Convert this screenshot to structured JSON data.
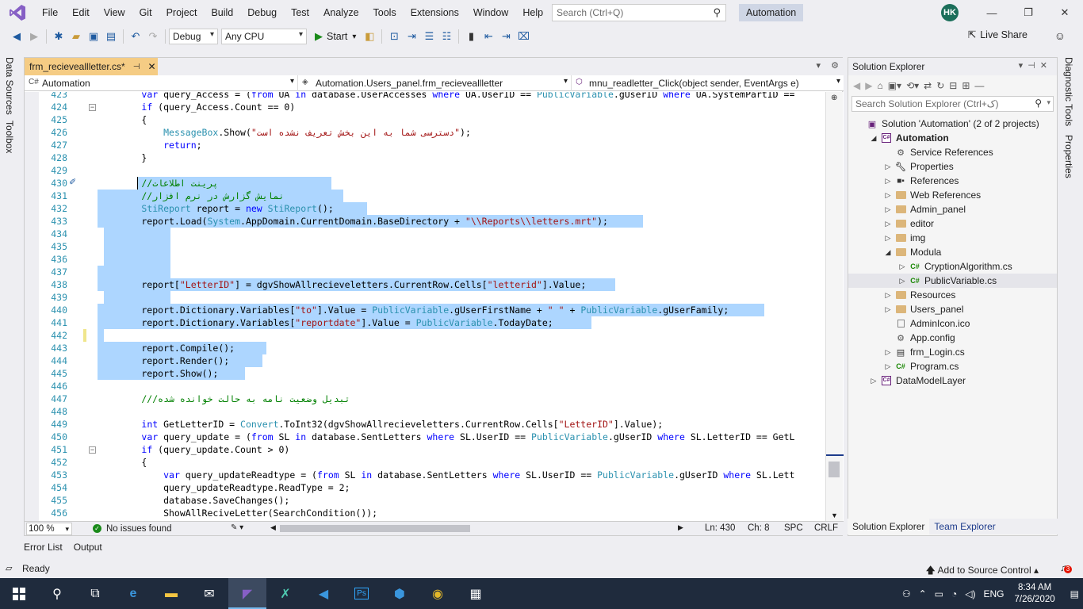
{
  "menu": {
    "items": [
      "File",
      "Edit",
      "View",
      "Git",
      "Project",
      "Build",
      "Debug",
      "Test",
      "Analyze",
      "Tools",
      "Extensions",
      "Window",
      "Help"
    ],
    "search_placeholder": "Search (Ctrl+Q)",
    "solution_badge": "Automation",
    "user_initials": "HK"
  },
  "toolbar": {
    "config": "Debug",
    "platform": "Any CPU",
    "start_label": "Start",
    "live_share": "Live Share"
  },
  "side_tabs": {
    "left": [
      "Data Sources",
      "Toolbox"
    ],
    "right": [
      "Diagnostic Tools",
      "Properties"
    ]
  },
  "editor": {
    "tab_title": "frm_recieveallletter.cs*",
    "nav_project": "Automation",
    "nav_class": "Automation.Users_panel.frm_recieveallletter",
    "nav_member": "mnu_readletter_Click(object sender, EventArgs e)",
    "lines": [
      {
        "n": "423",
        "code": "            var query_Access = (from UA in database.UserAccesses where UA.UserID == PublicVariable.gUserID where UA.SystemPartID =="
      },
      {
        "n": "424",
        "code": "            if (query_Access.Count == 0)"
      },
      {
        "n": "425",
        "code": "            {"
      },
      {
        "n": "426",
        "code": "                MessageBox.Show(\"دسترسی شما به این بخش تعریف نشده است\");"
      },
      {
        "n": "427",
        "code": "                return;"
      },
      {
        "n": "428",
        "code": "            }"
      },
      {
        "n": "429",
        "code": ""
      },
      {
        "n": "430",
        "code": "            //پرینت اطلاعات"
      },
      {
        "n": "431",
        "code": "            //نمایش گزارش در نرم افزار"
      },
      {
        "n": "432",
        "code": "            StiReport report = new StiReport();"
      },
      {
        "n": "433",
        "code": "            report.Load(System.AppDomain.CurrentDomain.BaseDirectory + \"\\\\Reports\\\\letters.mrt\");"
      },
      {
        "n": "434",
        "code": ""
      },
      {
        "n": "435",
        "code": ""
      },
      {
        "n": "436",
        "code": ""
      },
      {
        "n": "437",
        "code": ""
      },
      {
        "n": "438",
        "code": "            report[\"LetterID\"] = dgvShowAllrecieveletters.CurrentRow.Cells[\"letterid\"].Value;"
      },
      {
        "n": "439",
        "code": ""
      },
      {
        "n": "440",
        "code": "            report.Dictionary.Variables[\"to\"].Value = PublicVariable.gUserFirstName + \" \" + PublicVariable.gUserFamily;"
      },
      {
        "n": "441",
        "code": "            report.Dictionary.Variables[\"reportdate\"].Value = PublicVariable.TodayDate;"
      },
      {
        "n": "442",
        "code": ""
      },
      {
        "n": "443",
        "code": "            report.Compile();"
      },
      {
        "n": "444",
        "code": "            report.Render();"
      },
      {
        "n": "445",
        "code": "            report.Show();"
      },
      {
        "n": "446",
        "code": ""
      },
      {
        "n": "447",
        "code": "            ///تبدیل وضعیت نامه به حالت خوانده شده"
      },
      {
        "n": "448",
        "code": ""
      },
      {
        "n": "449",
        "code": "            int GetLetterID = Convert.ToInt32(dgvShowAllrecieveletters.CurrentRow.Cells[\"LetterID\"].Value);"
      },
      {
        "n": "450",
        "code": "            var query_update = (from SL in database.SentLetters where SL.UserID == PublicVariable.gUserID where SL.LetterID == GetL"
      },
      {
        "n": "451",
        "code": "            if (query_update.Count > 0)"
      },
      {
        "n": "452",
        "code": "            {"
      },
      {
        "n": "453",
        "code": "                var query_updateReadtype = (from SL in database.SentLetters where SL.UserID == PublicVariable.gUserID where SL.Lett"
      },
      {
        "n": "454",
        "code": "                query_updateReadtype.ReadType = 2;"
      },
      {
        "n": "455",
        "code": "                database.SaveChanges();"
      },
      {
        "n": "456",
        "code": "                ShowAllReciveLetter(SearchCondition());"
      }
    ],
    "zoom": "100 %",
    "issues": "No issues found",
    "ln": "Ln: 430",
    "ch": "Ch: 8",
    "spc": "SPC",
    "crlf": "CRLF"
  },
  "solution_explorer": {
    "title": "Solution Explorer",
    "search_placeholder": "Search Solution Explorer (Ctrl+ک)",
    "nodes": [
      {
        "label": "Solution 'Automation' (2 of 2 projects)",
        "level": 0,
        "arrow": "",
        "icon": "solution"
      },
      {
        "label": "Automation",
        "level": 1,
        "arrow": "◢",
        "icon": "csproj",
        "bold": true
      },
      {
        "label": "Service References",
        "level": 2,
        "arrow": "",
        "icon": "service"
      },
      {
        "label": "Properties",
        "level": 2,
        "arrow": "▷",
        "icon": "wrench"
      },
      {
        "label": "References",
        "level": 2,
        "arrow": "▷",
        "icon": "refs"
      },
      {
        "label": "Web References",
        "level": 2,
        "arrow": "▷",
        "icon": "folder"
      },
      {
        "label": "Admin_panel",
        "level": 2,
        "arrow": "▷",
        "icon": "folder"
      },
      {
        "label": "editor",
        "level": 2,
        "arrow": "▷",
        "icon": "folder"
      },
      {
        "label": "img",
        "level": 2,
        "arrow": "▷",
        "icon": "folder"
      },
      {
        "label": "Modula",
        "level": 2,
        "arrow": "◢",
        "icon": "folder"
      },
      {
        "label": "CryptionAlgorithm.cs",
        "level": 3,
        "arrow": "▷",
        "icon": "cs"
      },
      {
        "label": "PublicVariable.cs",
        "level": 3,
        "arrow": "▷",
        "icon": "cs",
        "selected": true
      },
      {
        "label": "Resources",
        "level": 2,
        "arrow": "▷",
        "icon": "folder"
      },
      {
        "label": "Users_panel",
        "level": 2,
        "arrow": "▷",
        "icon": "folder"
      },
      {
        "label": "AdminIcon.ico",
        "level": 2,
        "arrow": "",
        "icon": "ico"
      },
      {
        "label": "App.config",
        "level": 2,
        "arrow": "",
        "icon": "config"
      },
      {
        "label": "frm_Login.cs",
        "level": 2,
        "arrow": "▷",
        "icon": "form"
      },
      {
        "label": "Program.cs",
        "level": 2,
        "arrow": "▷",
        "icon": "cs"
      },
      {
        "label": "DataModelLayer",
        "level": 1,
        "arrow": "▷",
        "icon": "csproj"
      }
    ],
    "bottom_tabs": [
      "Solution Explorer",
      "Team Explorer"
    ]
  },
  "bottom_tool_tabs": [
    "Error List",
    "Output"
  ],
  "status": {
    "ready": "Ready",
    "source_control": "Add to Source Control",
    "notifications": "3"
  },
  "taskbar": {
    "lang": "ENG",
    "time": "8:34 AM",
    "date": "7/26/2020"
  }
}
